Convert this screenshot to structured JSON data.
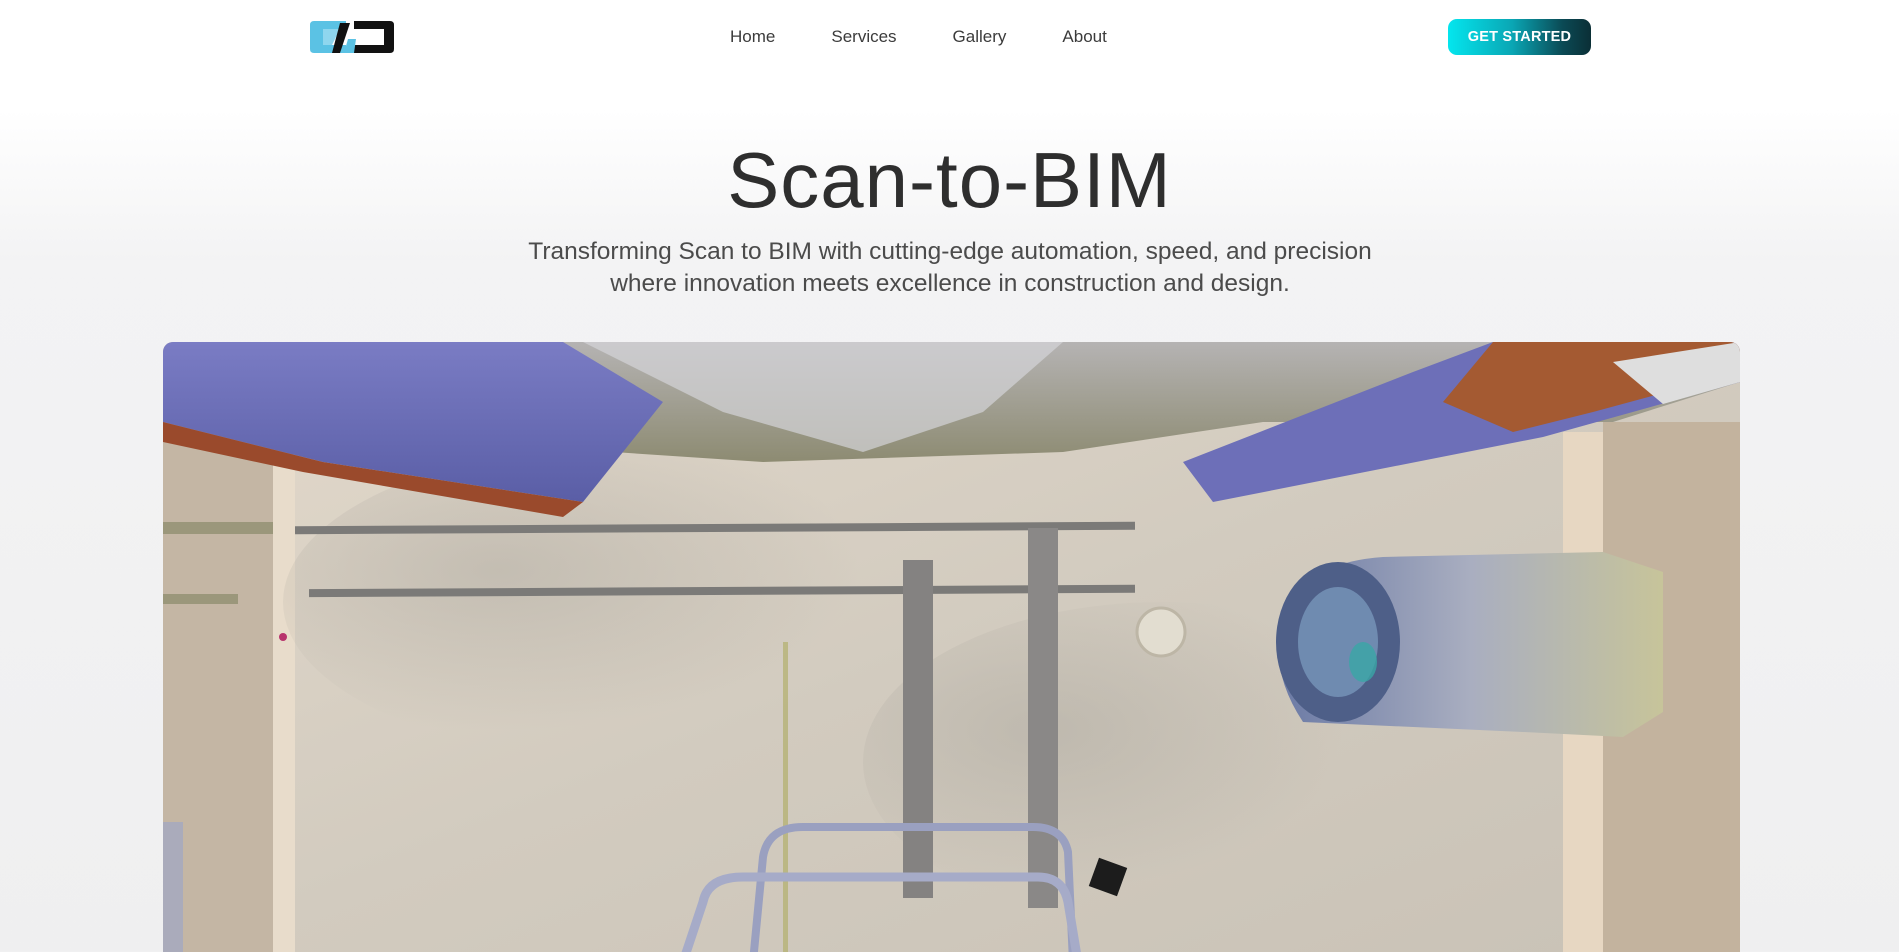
{
  "brand": {
    "logo_name": "cvd-logo",
    "colors": {
      "logo_light": "#5bc2e4",
      "logo_dark": "#111111"
    }
  },
  "nav": {
    "links": [
      {
        "label": "Home"
      },
      {
        "label": "Services"
      },
      {
        "label": "Gallery"
      },
      {
        "label": "About"
      }
    ],
    "cta_label": "GET STARTED"
  },
  "hero": {
    "title": "Scan-to-BIM",
    "subtitle_line1": "Transforming Scan to BIM with cutting-edge automation, speed, and precision",
    "subtitle_line2": "where innovation meets excellence in construction and design."
  },
  "colors": {
    "accent_start": "#04e6ee",
    "accent_end": "#0b2f36",
    "title": "#2e2e2e"
  }
}
